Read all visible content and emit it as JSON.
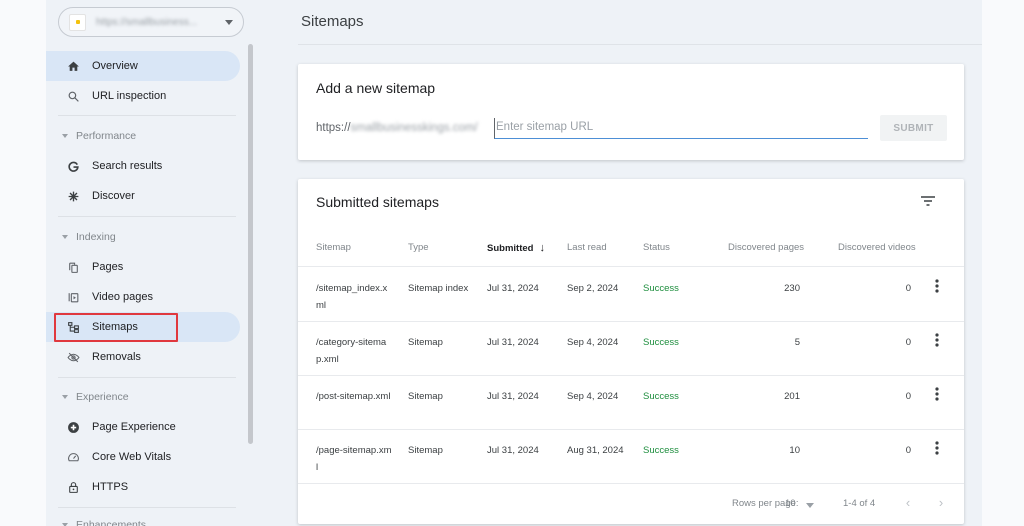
{
  "property": {
    "url": "https://smallbusiness..."
  },
  "sidebar": {
    "top_items": [
      {
        "label": "Overview",
        "icon": "home-icon",
        "active": true
      },
      {
        "label": "URL inspection",
        "icon": "search-icon"
      }
    ],
    "sections": [
      {
        "label": "Performance",
        "items": [
          {
            "label": "Search results",
            "icon": "google-g-icon"
          },
          {
            "label": "Discover",
            "icon": "asterisk-icon"
          }
        ]
      },
      {
        "label": "Indexing",
        "items": [
          {
            "label": "Pages",
            "icon": "pages-icon"
          },
          {
            "label": "Video pages",
            "icon": "video-pages-icon"
          },
          {
            "label": "Sitemaps",
            "icon": "sitemap-icon",
            "active": true
          },
          {
            "label": "Removals",
            "icon": "removals-icon"
          }
        ]
      },
      {
        "label": "Experience",
        "items": [
          {
            "label": "Page Experience",
            "icon": "page-experience-icon"
          },
          {
            "label": "Core Web Vitals",
            "icon": "gauge-icon"
          },
          {
            "label": "HTTPS",
            "icon": "lock-icon"
          }
        ]
      },
      {
        "label": "Enhancements",
        "items": []
      }
    ]
  },
  "main": {
    "title": "Sitemaps",
    "add_card": {
      "title": "Add a new sitemap",
      "prefix_scheme": "https://",
      "prefix_domain": "smallbusinesskings.com/",
      "input_placeholder": "Enter sitemap URL",
      "input_value": "",
      "submit_label": "SUBMIT"
    },
    "submitted": {
      "title": "Submitted sitemaps",
      "columns": [
        "Sitemap",
        "Type",
        "Submitted",
        "Last read",
        "Status",
        "Discovered pages",
        "Discovered videos"
      ],
      "sort_column": "Submitted",
      "sort_direction": "descending",
      "rows": [
        {
          "sitemap": "/sitemap_index.xml",
          "type": "Sitemap index",
          "submitted": "Jul 31, 2024",
          "last_read": "Sep 2, 2024",
          "status": "Success",
          "pages": "230",
          "videos": "0"
        },
        {
          "sitemap": "/category-sitemap.xml",
          "type": "Sitemap",
          "submitted": "Jul 31, 2024",
          "last_read": "Sep 4, 2024",
          "status": "Success",
          "pages": "5",
          "videos": "0"
        },
        {
          "sitemap": "/post-sitemap.xml",
          "type": "Sitemap",
          "submitted": "Jul 31, 2024",
          "last_read": "Sep 4, 2024",
          "status": "Success",
          "pages": "201",
          "videos": "0"
        },
        {
          "sitemap": "/page-sitemap.xml",
          "type": "Sitemap",
          "submitted": "Jul 31, 2024",
          "last_read": "Aug 31, 2024",
          "status": "Success",
          "pages": "10",
          "videos": "0"
        }
      ],
      "footer": {
        "rows_per_page_label": "Rows per page:",
        "rows_per_page_value": "10",
        "range": "1-4 of 4",
        "prev": "‹",
        "next": "›"
      }
    }
  },
  "colors": {
    "success": "#1e8e3e",
    "active_nav": "#d9e6f6",
    "highlight": "#e0383e",
    "input_underline": "#4d8fd6"
  }
}
